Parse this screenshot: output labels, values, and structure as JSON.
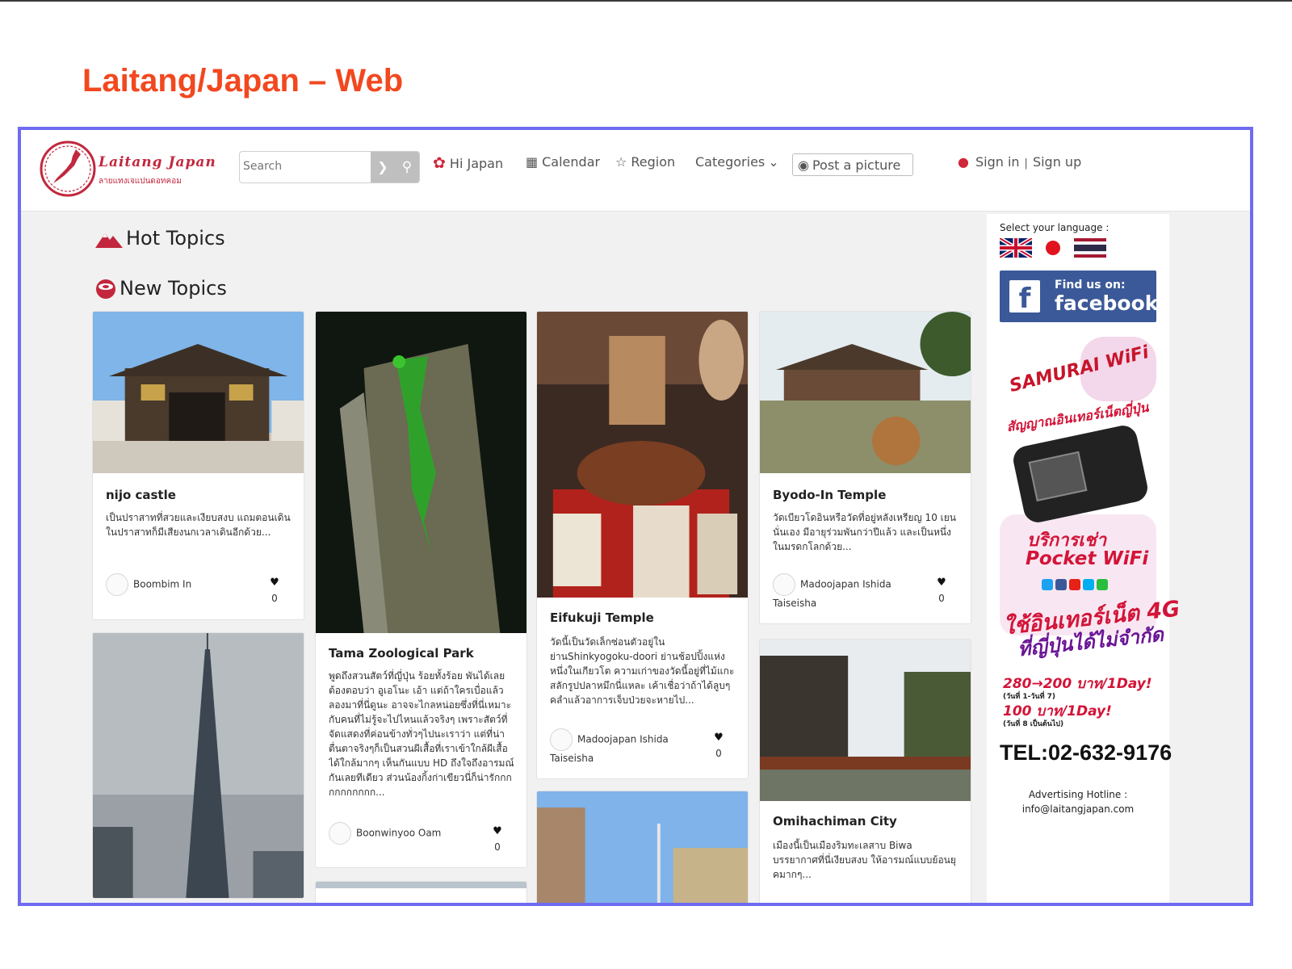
{
  "slide_title": "Laitang/Japan – Web",
  "header": {
    "logo_name": "Laitang Japan",
    "logo_sub": "ลายแทงเจแปนดอทคอม",
    "search_placeholder": "Search",
    "nav": {
      "hi_japan": "Hi Japan",
      "calendar": "Calendar",
      "region": "Region",
      "categories": "Categories"
    },
    "post_picture": "Post a picture",
    "sign_in": "Sign in",
    "auth_sep": "|",
    "sign_up": "Sign up"
  },
  "sections": {
    "hot": "Hot Topics",
    "new": "New Topics"
  },
  "cards": [
    {
      "title": "nijo castle",
      "desc": "เป็นปราสาทที่สวยและเงียบสงบ แถมตอนเดินในปราสาทก็มีเสียงนกเวลาเดินอีกด้วย...",
      "author": "Boombim In",
      "place": "",
      "likes": "0"
    },
    {
      "title": "Tama Zoological Park",
      "desc": "พูดถึงสวนสัตว์ที่ญี่ปุ่น ร้อยทั้งร้อย พันได้เลยต้องตอบว่า อูเอโนะ เอ้า แต่ถ้าใครเบื่อแล้วลองมาที่นี่ดูนะ อาจจะไกลหน่อยซึ่งที่นี่เหมาะกับคนที่ไม่รู้จะไปไหนแล้วจริงๆ เพราะสัตว์ที่จัดแสดงที่ค่อนข้างทั่วๆไปนะเราว่า แต่ที่น่าตื่นตาจริงๆก็เป็นสวนผีเสื้อที่เราเข้าใกล้ผีเสื้อได้ใกล้มากๆ เห็นกันแบบ HD ถึงใจถึงอารมณ์กันเลยทีเดียว ส่วนน้องกิ้งก่าเขียวนี่ก็น่ารักกกกกกกกกกก...",
      "author": "Boonwinyoo Oam",
      "place": "",
      "likes": "0"
    },
    {
      "title": "Eifukuji Temple",
      "desc": "วัดนี้เป็นวัดเล็กซ่อนตัวอยู่ในย่านShinkyogoku-doori ย่านช้อปปิ้งแห่งหนึ่งในเกียวโต ความเก่าของวัดนี้อยู่ที่ไม้แกะสลักรูปปลาหมึกนี่แหละ เค้าเชื่อว่าถ้าได้ลูบๆคลำแล้วอาการเจ็บป่วยจะหายไป...",
      "author": "Madoojapan Ishida",
      "place": "Taiseisha",
      "likes": "0"
    },
    {
      "title": "Byodo-In Temple",
      "desc": "วัดเบียวโดอินหรือวัดที่อยู่หลังเหรียญ 10 เยน นั่นเอง มีอายุร่วมพันกว่าปีแล้ว และเป็นหนึ่งในมรดกโลกด้วย...",
      "author": "Madoojapan Ishida",
      "place": "Taiseisha",
      "likes": "0"
    },
    {
      "title": "Omihachiman City",
      "desc": "เมืองนี้เป็นเมืองริมทะเลสาบ Biwa บรรยากาศที่นี่เงียบสงบ ให้อารมณ์แบบย้อนยุคมากๆ...",
      "author": "",
      "place": "",
      "likes": ""
    }
  ],
  "sidebar": {
    "lang_label": "Select your language :",
    "fb_find": "Find us on:",
    "fb_word": "facebook",
    "ad": {
      "samurai": "SAMURAI WiFi",
      "tagline": "สัญญาณอินเทอร์เน็ตญี่ปุ่น",
      "pocket1": "บริการเช่า",
      "pocket2": "Pocket WiFi",
      "net1": "ใช้อินเทอร์เน็ต 4G",
      "net2": "ที่ญี่ปุ่นได้ไม่จำกัด",
      "price1": "280→200 บาท/1Day!",
      "small1": "(วันที่ 1-วันที่ 7)",
      "price2": "100 บาท/1Day!",
      "small2": "(วันที่ 8 เป็นต้นไป)",
      "tel": "TEL:02-632-9176"
    },
    "adv_label": "Advertising Hotline :",
    "adv_email": "info@laitangjapan.com"
  },
  "colors": {
    "accent": "#f2481f",
    "frame": "#6f6bf2",
    "brand_red": "#c2273d",
    "facebook": "#3b5998"
  },
  "icons": [
    "search-icon",
    "chevron-down-icon",
    "flower-icon",
    "grid-icon",
    "star-icon",
    "camera-icon",
    "user-icon",
    "mountain-icon",
    "sushi-icon",
    "heart-icon"
  ]
}
